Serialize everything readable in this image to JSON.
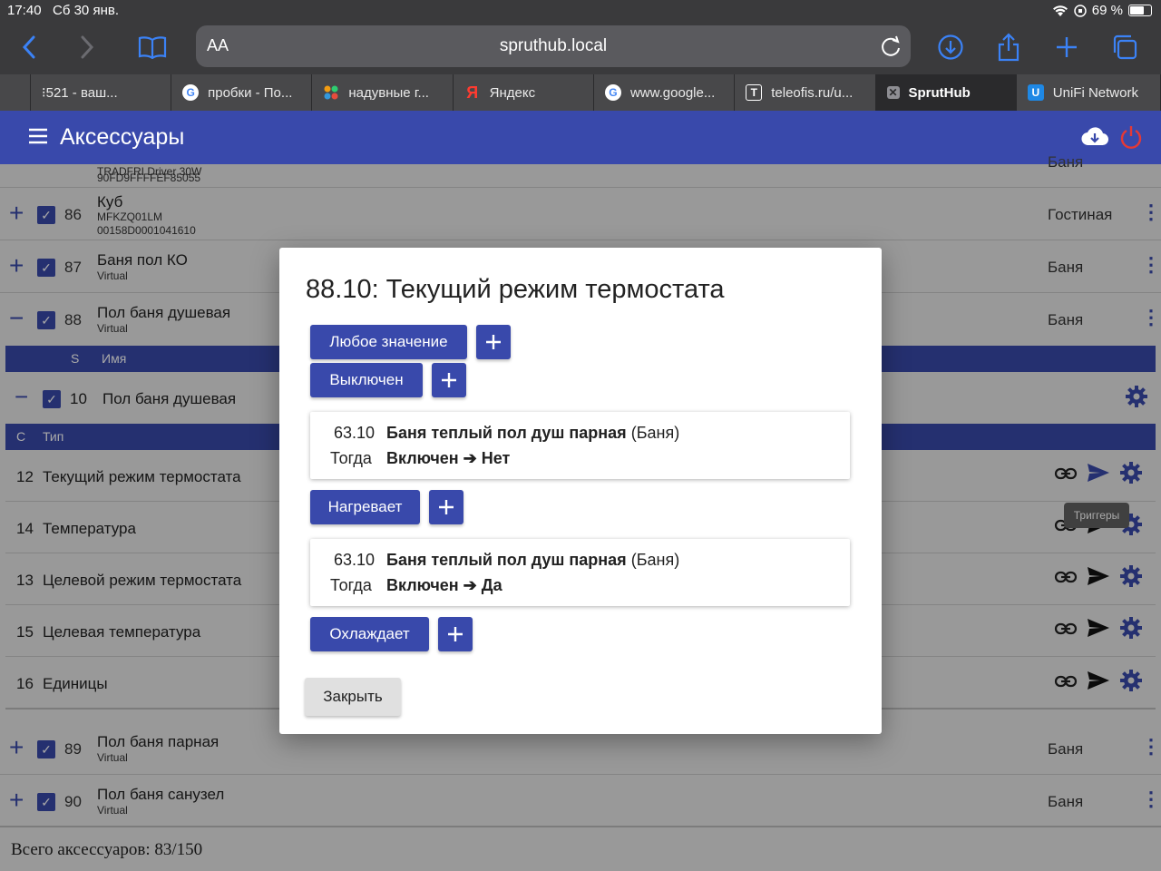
{
  "status_bar": {
    "time": "17:40",
    "date": "Сб 30 янв.",
    "battery": "69 %"
  },
  "browser": {
    "aa_label": "AA",
    "url": "spruthub.local",
    "tabs": [
      {
        "label": "⁝521 - ваш...",
        "icon": "blank"
      },
      {
        "label": "пробки - По...",
        "icon": "google",
        "color": "#4285f4"
      },
      {
        "label": "надувные г...",
        "icon": "dots",
        "color": "#e74c3c"
      },
      {
        "label": "Яндекс",
        "icon": "yandex",
        "color": "#ff3b30"
      },
      {
        "label": "www.google...",
        "icon": "google",
        "color": "#4285f4"
      },
      {
        "label": "teleofis.ru/u...",
        "icon": "T",
        "color": "#ffffff"
      },
      {
        "label": "SprutHub",
        "icon": "close",
        "color": "#8e8e93"
      },
      {
        "label": "UniFi Network",
        "icon": "U",
        "color": "#1e88e5"
      }
    ]
  },
  "app": {
    "title": "Аксессуары",
    "accent": "#3949ab",
    "power_color": "#e53935"
  },
  "list": {
    "top_partial": {
      "sub1": "TRADFRI Driver 30W",
      "sub2": "90FD9FFFFEF85055",
      "room": "Баня"
    },
    "rows": [
      {
        "num": "86",
        "name": "Куб",
        "sub": "MFKZQ01LM",
        "sub2": "00158D0001041610",
        "room": "Гостиная"
      },
      {
        "num": "87",
        "name": "Баня пол КО",
        "sub": "Virtual",
        "room": "Баня"
      },
      {
        "num": "88",
        "name": "Пол баня душевая",
        "sub": "Virtual",
        "room": "Баня"
      },
      {
        "num": "89",
        "name": "Пол баня парная",
        "sub": "Virtual",
        "room": "Баня"
      },
      {
        "num": "90",
        "name": "Пол баня санузел",
        "sub": "Virtual",
        "room": "Баня"
      }
    ],
    "service_header": {
      "s": "S",
      "name": "Имя"
    },
    "service": {
      "num": "10",
      "name": "Пол баня душевая"
    },
    "char_header": {
      "c": "С",
      "type": "Тип"
    },
    "characteristics": [
      {
        "num": "12",
        "name": "Текущий режим термостата"
      },
      {
        "num": "14",
        "name": "Температура"
      },
      {
        "num": "13",
        "name": "Целевой режим термостата"
      },
      {
        "num": "15",
        "name": "Целевая температура"
      },
      {
        "num": "16",
        "name": "Единицы"
      }
    ],
    "tooltip": "Триггеры",
    "footer": "Всего аксессуаров: 83/150"
  },
  "dialog": {
    "title": "88.10: Текущий режим термостата",
    "any_value_label": "Любое значение",
    "off_label": "Выключен",
    "heating_label": "Нагревает",
    "cooling_label": "Охлаждает",
    "plus": "+",
    "triggers": [
      {
        "id": "63.10",
        "device": "Баня теплый пол душ парная",
        "room": "(Баня)",
        "then": "Тогда",
        "result": "Включен ➔ Нет"
      },
      {
        "id": "63.10",
        "device": "Баня теплый пол душ парная",
        "room": "(Баня)",
        "then": "Тогда",
        "result": "Включен ➔ Да"
      }
    ],
    "close_label": "Закрыть"
  }
}
